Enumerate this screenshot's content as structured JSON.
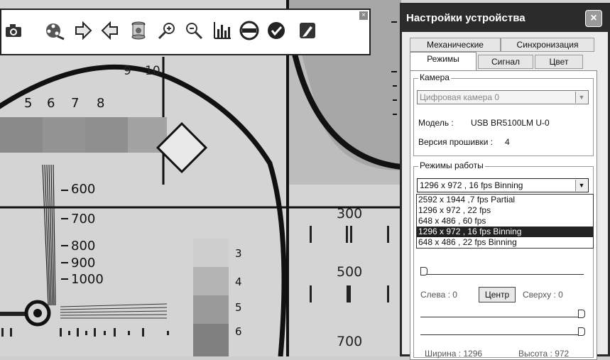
{
  "toolbar": {
    "buttons": [
      "camera-icon",
      "film-reel-icon",
      "arrow-right-icon",
      "arrow-left-icon",
      "spool-icon",
      "zoom-in-icon",
      "zoom-out-icon",
      "histogram-icon",
      "minus-circle-icon",
      "check-circle-icon",
      "edit-note-icon"
    ],
    "close_label": "×"
  },
  "chart_bg": {
    "top_numbers": [
      "9",
      "10"
    ],
    "row_numbers": [
      "5",
      "6",
      "7",
      "8"
    ],
    "scale_labels": [
      "600",
      "700",
      "800",
      "900",
      "1000"
    ],
    "gray_numbers": [
      "3",
      "4",
      "5",
      "6"
    ],
    "column_labels": [
      "300",
      "500",
      "700"
    ]
  },
  "dialog": {
    "title": "Настройки устройства",
    "close": "×",
    "tabs_row1": [
      "Механические",
      "Синхронизация"
    ],
    "tabs_row2": [
      "Режимы",
      "Сигнал",
      "Цвет"
    ],
    "camera_group": {
      "title": "Камера",
      "camera_select": "Цифровая камера 0",
      "model_label": "Модель :",
      "model_value": "USB BR5100LM U-0",
      "firmware_label": "Версия прошивки :",
      "firmware_value": "4"
    },
    "modes_group": {
      "title": "Режимы работы",
      "selected": "1296 x 972 , 16 fps Binning",
      "options": [
        "2592 x 1944 ,7 fps Partial",
        "1296 x 972 , 22 fps",
        "648 x 486 , 60 fps",
        "1296 x 972 , 16 fps Binning",
        "648 x 486 , 22 fps Binning"
      ],
      "highlighted_index": 3
    },
    "position": {
      "left_label": "Слева : 0",
      "center_button": "Центр",
      "top_label": "Сверху : 0",
      "width_label": "Ширина : 1296",
      "height_label": "Высота : 972"
    }
  }
}
